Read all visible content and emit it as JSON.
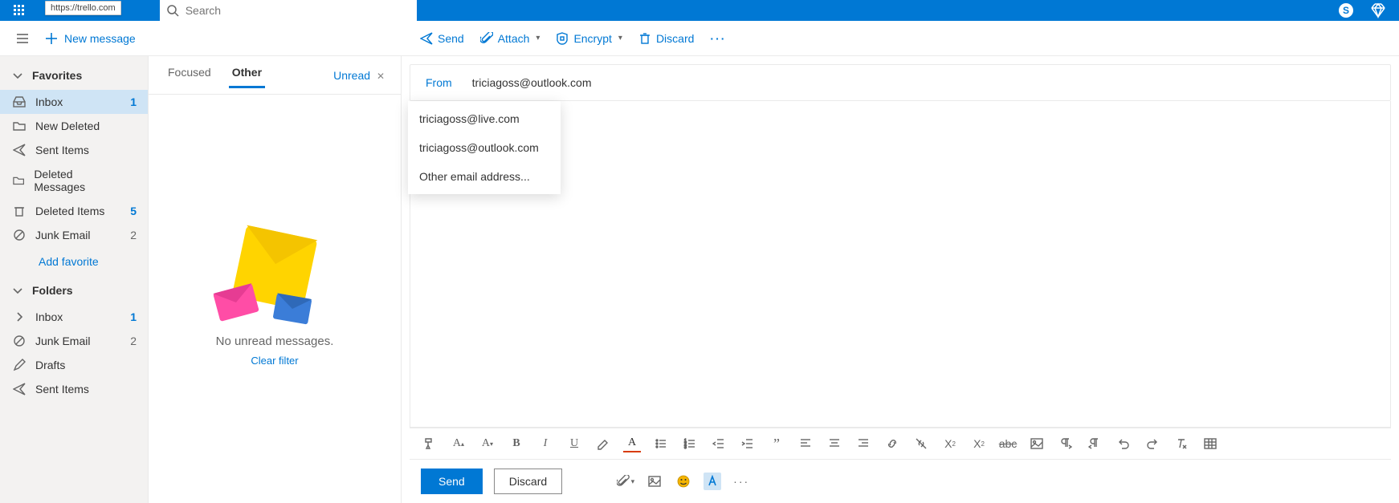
{
  "header": {
    "url_tooltip": "https://trello.com",
    "search_placeholder": "Search"
  },
  "app_row": {
    "new_message": "New message"
  },
  "commands": {
    "send": "Send",
    "attach": "Attach",
    "encrypt": "Encrypt",
    "discard": "Discard"
  },
  "sidebar": {
    "favorites_label": "Favorites",
    "folders_label": "Folders",
    "add_favorite": "Add favorite",
    "fav": [
      {
        "label": "Inbox",
        "count": "1"
      },
      {
        "label": "New Deleted",
        "count": ""
      },
      {
        "label": "Sent Items",
        "count": ""
      },
      {
        "label": "Deleted Messages",
        "count": ""
      },
      {
        "label": "Deleted Items",
        "count": "5"
      },
      {
        "label": "Junk Email",
        "count": "2"
      }
    ],
    "folders": [
      {
        "label": "Inbox",
        "count": "1"
      },
      {
        "label": "Junk Email",
        "count": "2"
      },
      {
        "label": "Drafts",
        "count": ""
      },
      {
        "label": "Sent Items",
        "count": ""
      }
    ]
  },
  "list": {
    "tab_focused": "Focused",
    "tab_other": "Other",
    "filter_label": "Unread",
    "empty_text": "No unread messages.",
    "clear_filter": "Clear filter"
  },
  "compose": {
    "from_label": "From",
    "from_value": "triciagoss@outlook.com",
    "dropdown": [
      "triciagoss@live.com",
      "triciagoss@outlook.com",
      "Other email address..."
    ],
    "send_btn": "Send",
    "discard_btn": "Discard"
  }
}
